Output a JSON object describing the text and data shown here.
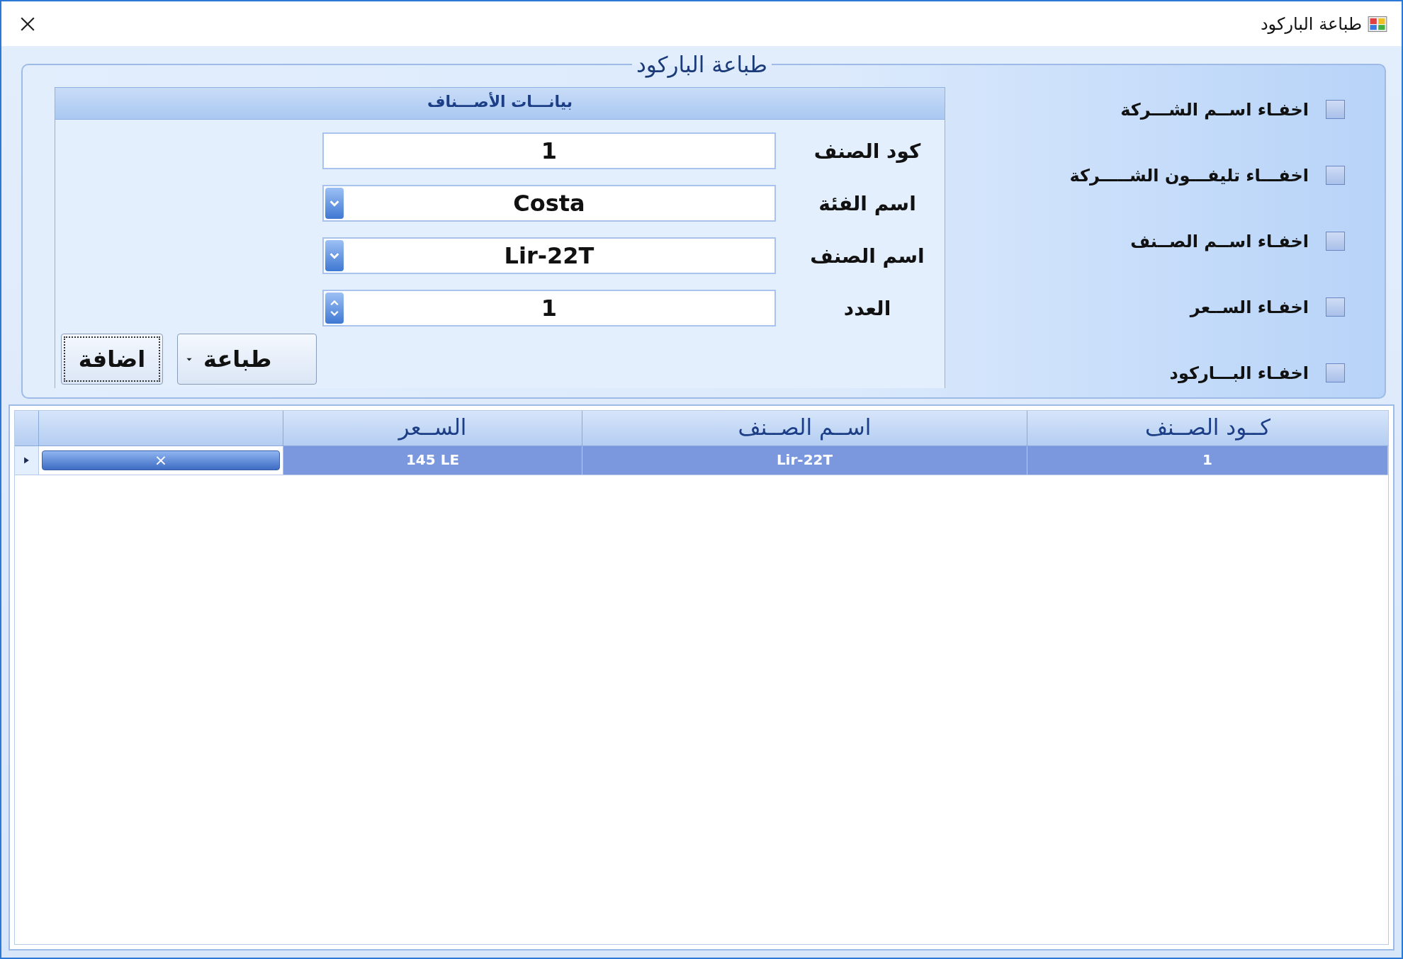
{
  "window": {
    "title": "طباعة الباركود"
  },
  "group": {
    "title": "طباعة الباركود"
  },
  "options": [
    {
      "label": "اخفـاء اســم الشـــركة",
      "checked": false
    },
    {
      "label": "اخفـــاء تليفـــون الشـــــركة",
      "checked": false
    },
    {
      "label": "اخفـاء اســم الصــنف",
      "checked": false
    },
    {
      "label": "اخفـاء الســعر",
      "checked": false
    },
    {
      "label": "اخفـاء البـــاركود",
      "checked": false
    }
  ],
  "items_panel": {
    "title": "بيانـــات الأصـــناف",
    "fields": [
      {
        "kind": "text",
        "label": "كود الصنف",
        "value": "1"
      },
      {
        "kind": "dropdown",
        "label": "اسم الفئة",
        "value": "Costa"
      },
      {
        "kind": "dropdown",
        "label": "اسم الصنف",
        "value": "Lir-22T"
      },
      {
        "kind": "spinner",
        "label": "العدد",
        "value": "1"
      }
    ],
    "buttons": [
      {
        "kind": "split",
        "label": "طباعة"
      },
      {
        "kind": "plain",
        "label": "اضافة"
      }
    ]
  },
  "table": {
    "columns": [
      "كــود الصــنف",
      "اســم الصــنف",
      "الســعر"
    ],
    "rows": [
      {
        "cells": [
          "1",
          "Lir-22T",
          "145 LE"
        ],
        "selected": true,
        "action": "×"
      }
    ]
  }
}
